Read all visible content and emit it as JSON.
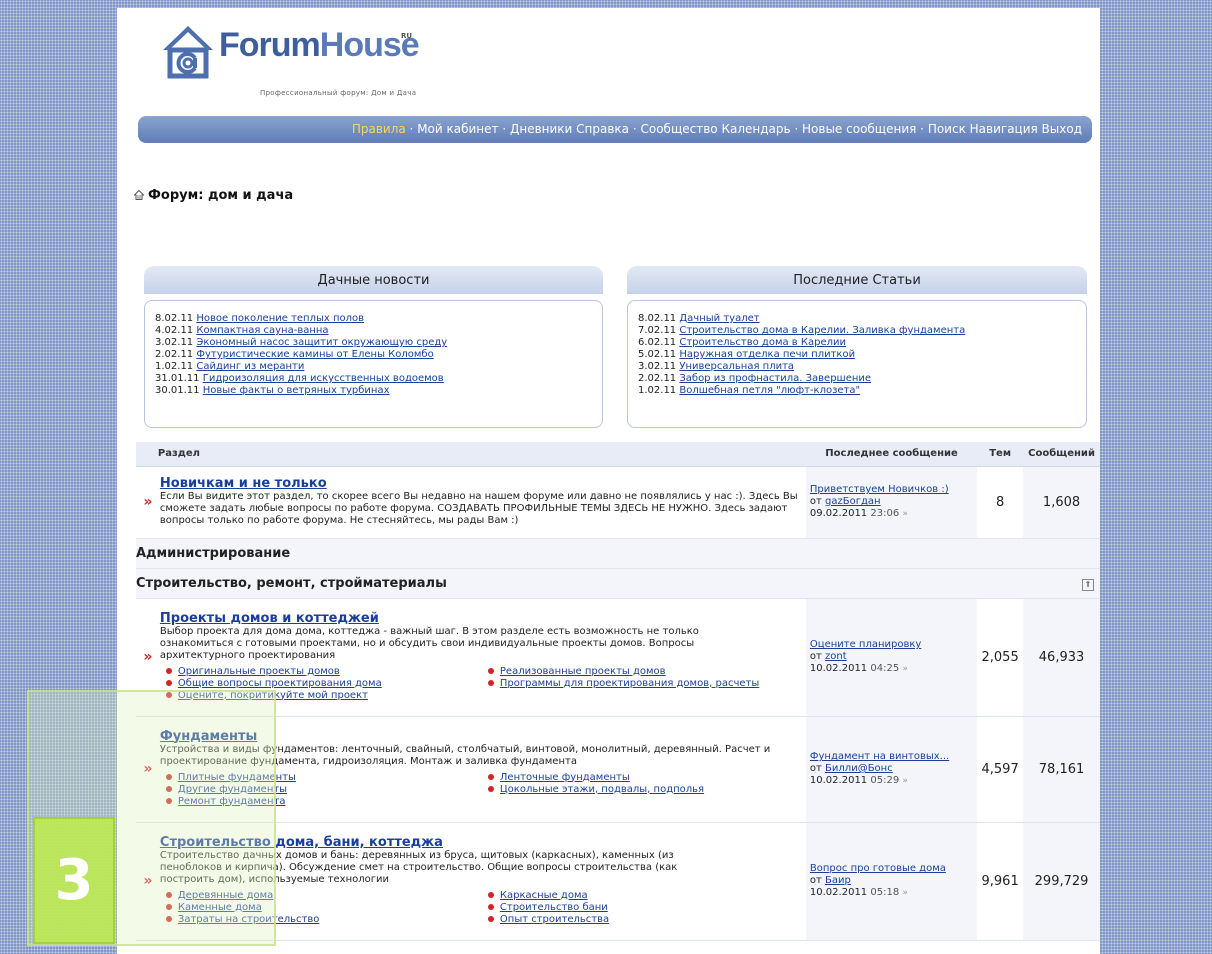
{
  "logo": {
    "part1": "Forum",
    "part2": "House",
    "sup": "RU",
    "tagline": "Профессиональный форум: Дом и Дача"
  },
  "nav": {
    "items": [
      "Правила",
      "Мой кабинет",
      "Дневники Справка",
      "Сообщество Календарь",
      "Новые сообщения",
      "Поиск Навигация Выход"
    ],
    "separator": "·"
  },
  "breadcrumb": {
    "title": "Форум: дом и дача"
  },
  "news": {
    "title": "Дачные новости",
    "items": [
      {
        "date": "8.02.11",
        "text": "Новое поколение теплых полов"
      },
      {
        "date": "4.02.11",
        "text": "Компактная сауна-ванна"
      },
      {
        "date": "3.02.11",
        "text": "Экономный насос защитит окружающую среду"
      },
      {
        "date": "2.02.11",
        "text": "Футуристические камины от Елены Коломбо"
      },
      {
        "date": "1.02.11",
        "text": "Сайдинг из меранти"
      },
      {
        "date": "31.01.11",
        "text": "Гидроизоляция для искусственных водоемов"
      },
      {
        "date": "30.01.11",
        "text": "Новые факты о ветряных турбинах"
      }
    ]
  },
  "articles": {
    "title": "Последние Статьи",
    "items": [
      {
        "date": "8.02.11",
        "text": "Дачный туалет"
      },
      {
        "date": "7.02.11",
        "text": "Строительство дома в Карелии. Заливка фундамента"
      },
      {
        "date": "6.02.11",
        "text": "Строительство дома в Карелии"
      },
      {
        "date": "5.02.11",
        "text": "Наружная отделка печи плиткой"
      },
      {
        "date": "3.02.11",
        "text": "Универсальная плита"
      },
      {
        "date": "2.02.11",
        "text": "Забор из профнастила. Завершение"
      },
      {
        "date": "1.02.11",
        "text": "Волшебная петля \"люфт-клозета\""
      }
    ]
  },
  "table": {
    "col_section": "Раздел",
    "col_last": "Последнее сообщение",
    "col_topics": "Тем",
    "col_posts": "Сообщений"
  },
  "newbie": {
    "title": "Новичкам и не только",
    "desc": "Если Вы видите этот раздел, то скорее всего Вы недавно на нашем форуме или давно не появлялись у нас :). Здесь Вы сможете задать любые вопросы по работе форума. СОЗДАВАТЬ ПРОФИЛЬНЫЕ ТЕМЫ ЗДЕСЬ НЕ НУЖНО. Здесь задают вопросы только по работе форума. Не стесняйтесь, мы рады Вам :)",
    "last_title": "Приветствуем Новичков :)",
    "last_from": "от",
    "last_user": "gazБогдан",
    "last_date": "09.02.2011",
    "last_time": "23:06",
    "topics": "8",
    "posts": "1,608"
  },
  "cat_admin": "Администрирование",
  "cat_build": "Строительство, ремонт, стройматериалы",
  "forums": [
    {
      "title": "Проекты домов и коттеджей",
      "desc": "Выбор проекта для дома дома, коттеджа - важный шаг. В этом разделе есть возможность не только ознакомиться с готовыми проектами, но и обсудить свои индивидуальные проекты домов. Вопросы архитектурного проектирования",
      "subs": [
        "Оригинальные проекты домов",
        "Реализованные проекты домов",
        "Общие вопросы проектирования дома",
        "Программы для проектирования домов, расчеты",
        "Оцените, покритикуйте мой проект"
      ],
      "last_title": "Оцените планировку",
      "last_from": "от",
      "last_user": "zont",
      "last_date": "10.02.2011",
      "last_time": "04:25",
      "topics": "2,055",
      "posts": "46,933"
    },
    {
      "title": "Фундаменты",
      "desc": "Устройства и виды фундаментов: ленточный, свайный, столбчатый, винтовой, монолитный, деревянный. Расчет и проектирование фундамента, гидроизоляция. Монтаж и заливка фундамента",
      "subs": [
        "Плитные фундаменты",
        "Ленточные фундаменты",
        "Другие фундаменты",
        "Цокольные этажи, подвалы, подполья",
        "Ремонт фундамента"
      ],
      "last_title": "Фундамент на винтовых...",
      "last_from": "от",
      "last_user": "Билли@Бонс",
      "last_date": "10.02.2011",
      "last_time": "05:29",
      "topics": "4,597",
      "posts": "78,161"
    },
    {
      "title": "Строительство дома, бани, коттеджа",
      "desc": "Строительство дачных домов и бань: деревянных из бруса, щитовых (каркасных), каменных (из пеноблоков и кирпича). Обсуждение смет на строительство. Общие вопросы строительства (как построить дом), используемые технологии",
      "subs": [
        "Деревянные дома",
        "Каркасные дома",
        "Каменные дома",
        "Строительство бани",
        "Затраты на строительство",
        "Опыт строительства"
      ],
      "last_title": "Вопрос про готовые дома",
      "last_from": "от",
      "last_user": "Баир",
      "last_date": "10.02.2011",
      "last_time": "05:18",
      "topics": "9,961",
      "posts": "299,729"
    }
  ],
  "badge": "3",
  "colors": {
    "nav": "#6b87bd",
    "link": "#1a3f9a",
    "bullet": "#d02525",
    "badge": "#bce854"
  }
}
